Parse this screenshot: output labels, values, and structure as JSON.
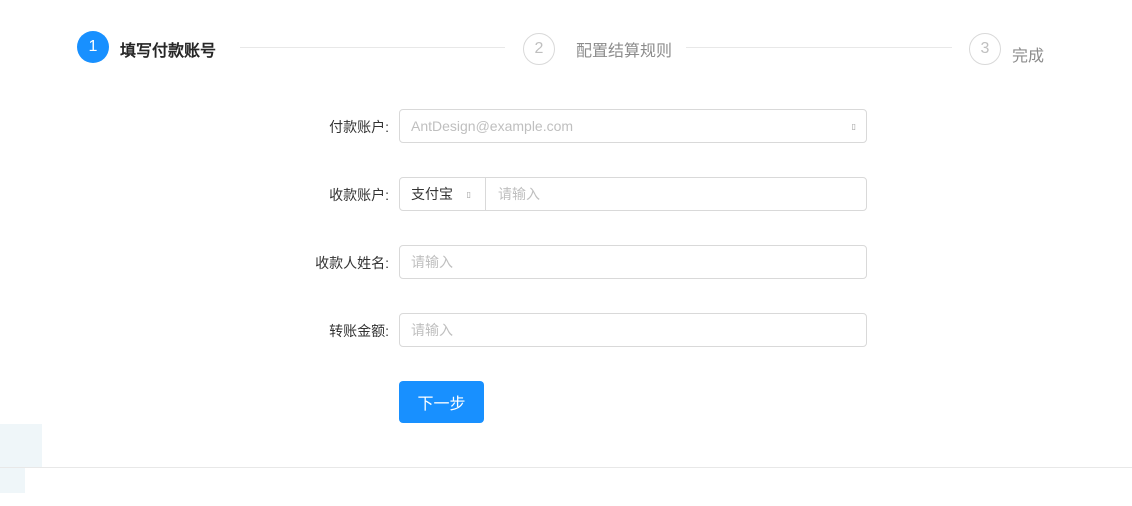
{
  "steps": [
    {
      "number": "1",
      "title": "填写付款账号",
      "status": "active"
    },
    {
      "number": "2",
      "title": "配置结算规则",
      "status": "wait"
    },
    {
      "number": "3",
      "title": "完成",
      "status": "wait"
    }
  ],
  "form": {
    "payer": {
      "label": "付款账户:",
      "value": "AntDesign@example.com"
    },
    "receiver": {
      "label": "收款账户:",
      "select_value": "支付宝",
      "placeholder": "请输入"
    },
    "receiver_name": {
      "label": "收款人姓名:",
      "placeholder": "请输入"
    },
    "amount": {
      "label": "转账金额:",
      "placeholder": "请输入"
    },
    "next_label": "下一步"
  },
  "colors": {
    "primary": "#1890ff"
  }
}
